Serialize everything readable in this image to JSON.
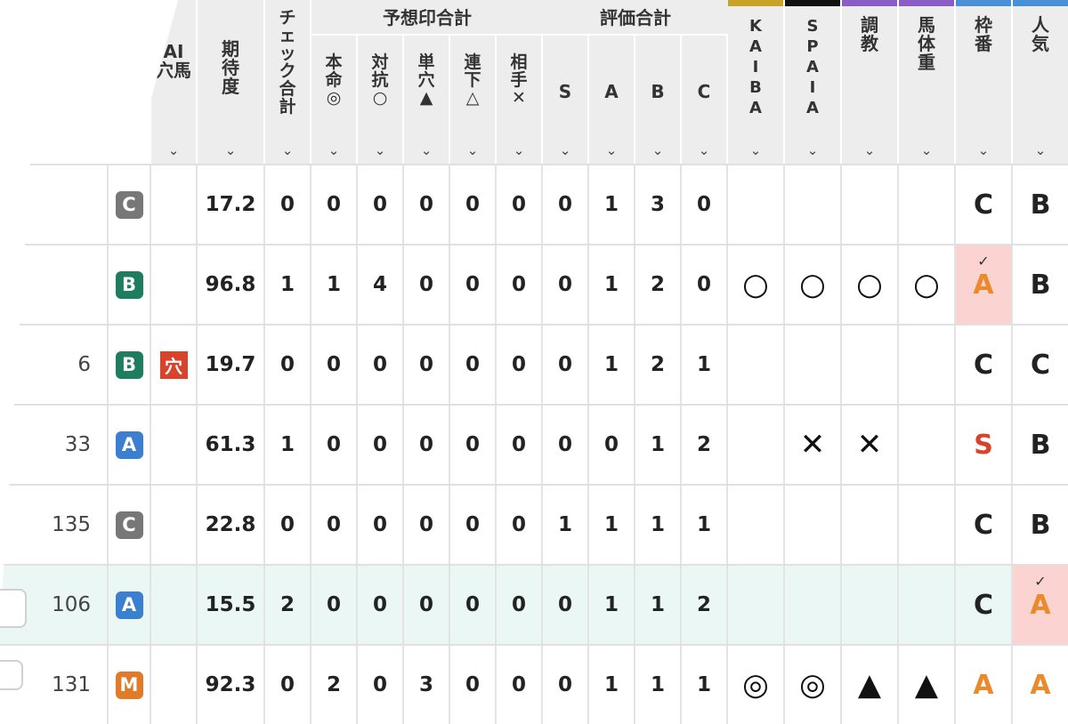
{
  "headers": {
    "ai_ana": "AI\n穴馬",
    "kitai": "期\n待\n度",
    "check": "チ\nェ\nッ\nク\n合\n計",
    "yosou_group": "予想印合計",
    "honmei": "本\n命\n◎",
    "taikou": "対\n抗\n○",
    "tanana": "単\n穴\n▲",
    "renka": "連\n下\n△",
    "aite": "相\n手\n✕",
    "hyouka_group": "評価合計",
    "s": "S",
    "a": "A",
    "b": "B",
    "c": "C",
    "kaiba": "K\nA\nI\nB\nA",
    "spaia": "S\nP\nA\nI\nA",
    "choukyou": "調\n教",
    "bataijuu": "馬\n体\n重",
    "wakuban": "枠\n番",
    "ninki": "人\n気",
    "chevron": "⌄"
  },
  "colors": {
    "kaiba_accent": "#c9a227",
    "spaia_accent": "#111111",
    "choukyou_accent": "#8a5cc7",
    "bataijuu_accent": "#8a5cc7",
    "wakuban_accent": "#4a90d9",
    "ninki_accent": "#4a90d9",
    "badge_A": "#3b7fd0",
    "badge_B": "#1e7d5f",
    "badge_C": "#777777",
    "badge_M": "#e07b2a",
    "grade_S": "#d9432c",
    "grade_A": "#e98a2c"
  },
  "rows": [
    {
      "num": "",
      "badge": "C",
      "ana": "",
      "kitai": "17.2",
      "check": "0",
      "marks": [
        "0",
        "0",
        "0",
        "0",
        "0"
      ],
      "eval": [
        "0",
        "1",
        "3",
        "0"
      ],
      "kaiba": "",
      "spaia": "",
      "choukyou": "",
      "bataijuu": "",
      "waku": "C",
      "ninki": "B",
      "waku_pink": false,
      "ninki_pink": false
    },
    {
      "num": "",
      "badge": "B",
      "ana": "",
      "kitai": "96.8",
      "check": "1",
      "marks": [
        "1",
        "4",
        "0",
        "0",
        "0"
      ],
      "eval": [
        "0",
        "1",
        "2",
        "0"
      ],
      "kaiba": "○",
      "spaia": "○",
      "choukyou": "○",
      "bataijuu": "○",
      "waku": "A",
      "ninki": "B",
      "waku_pink": true,
      "ninki_pink": false
    },
    {
      "num": "6",
      "badge": "B",
      "ana": "穴",
      "kitai": "19.7",
      "check": "0",
      "marks": [
        "0",
        "0",
        "0",
        "0",
        "0"
      ],
      "eval": [
        "0",
        "1",
        "2",
        "1"
      ],
      "kaiba": "",
      "spaia": "",
      "choukyou": "",
      "bataijuu": "",
      "waku": "C",
      "ninki": "C",
      "waku_pink": false,
      "ninki_pink": false
    },
    {
      "num": "33",
      "badge": "A",
      "ana": "",
      "kitai": "61.3",
      "check": "1",
      "marks": [
        "0",
        "0",
        "0",
        "0",
        "0"
      ],
      "eval": [
        "0",
        "0",
        "1",
        "2"
      ],
      "kaiba": "",
      "spaia": "✕",
      "choukyou": "✕",
      "bataijuu": "",
      "waku": "S",
      "ninki": "B",
      "waku_pink": false,
      "ninki_pink": false
    },
    {
      "num": "135",
      "badge": "C",
      "ana": "",
      "kitai": "22.8",
      "check": "0",
      "marks": [
        "0",
        "0",
        "0",
        "0",
        "0"
      ],
      "eval": [
        "1",
        "1",
        "1",
        "1"
      ],
      "kaiba": "",
      "spaia": "",
      "choukyou": "",
      "bataijuu": "",
      "waku": "C",
      "ninki": "B",
      "waku_pink": false,
      "ninki_pink": false
    },
    {
      "num": "106",
      "badge": "A",
      "ana": "",
      "kitai": "15.5",
      "check": "2",
      "marks": [
        "0",
        "0",
        "0",
        "0",
        "0"
      ],
      "eval": [
        "0",
        "1",
        "1",
        "2"
      ],
      "kaiba": "",
      "spaia": "",
      "choukyou": "",
      "bataijuu": "",
      "waku": "C",
      "ninki": "A",
      "waku_pink": false,
      "ninki_pink": true
    },
    {
      "num": "131",
      "badge": "M",
      "ana": "",
      "kitai": "92.3",
      "check": "0",
      "marks": [
        "2",
        "0",
        "3",
        "0",
        "0"
      ],
      "eval": [
        "0",
        "1",
        "1",
        "1"
      ],
      "kaiba": "◎",
      "spaia": "◎",
      "choukyou": "▲",
      "bataijuu": "▲",
      "waku": "A",
      "ninki": "A",
      "waku_pink": false,
      "ninki_pink": false
    }
  ]
}
